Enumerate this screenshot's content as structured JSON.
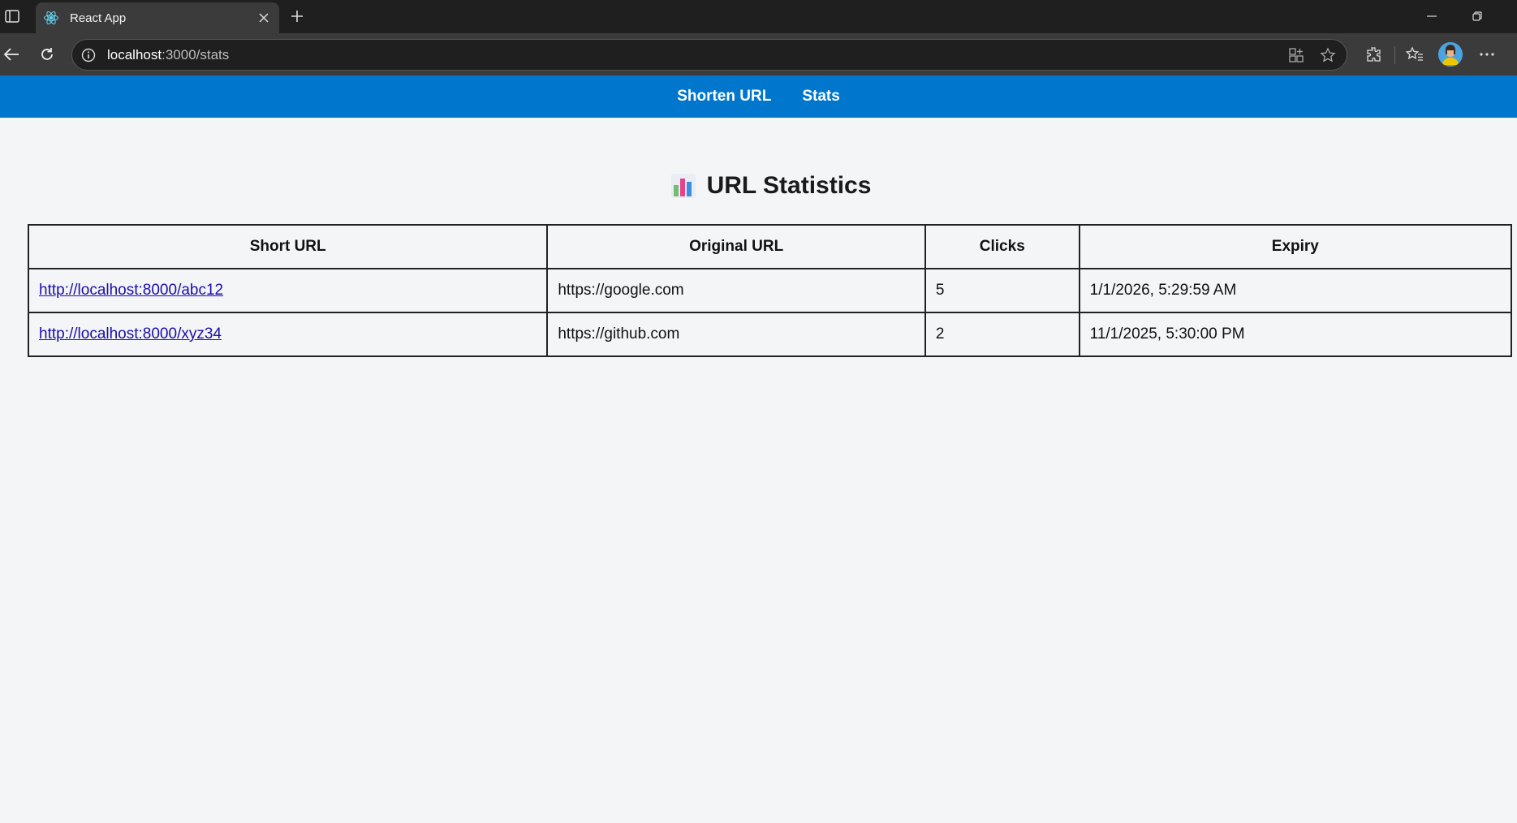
{
  "browser": {
    "tab_title": "React App",
    "url_host": "localhost",
    "url_path": ":3000/stats"
  },
  "nav": {
    "shorten_label": "Shorten URL",
    "stats_label": "Stats"
  },
  "page": {
    "title": "URL Statistics",
    "icon": "bar-chart-emoji"
  },
  "table": {
    "headers": [
      "Short URL",
      "Original URL",
      "Clicks",
      "Expiry"
    ],
    "rows": [
      {
        "short_url": "http://localhost:8000/abc12",
        "original_url": "https://google.com",
        "clicks": "5",
        "expiry": "1/1/2026, 5:29:59 AM"
      },
      {
        "short_url": "http://localhost:8000/xyz34",
        "original_url": "https://github.com",
        "clicks": "2",
        "expiry": "11/1/2025, 5:30:00 PM"
      }
    ]
  },
  "colors": {
    "nav_bg": "#0077cc",
    "page_bg": "#f4f5f7",
    "link": "#1a0dab"
  }
}
